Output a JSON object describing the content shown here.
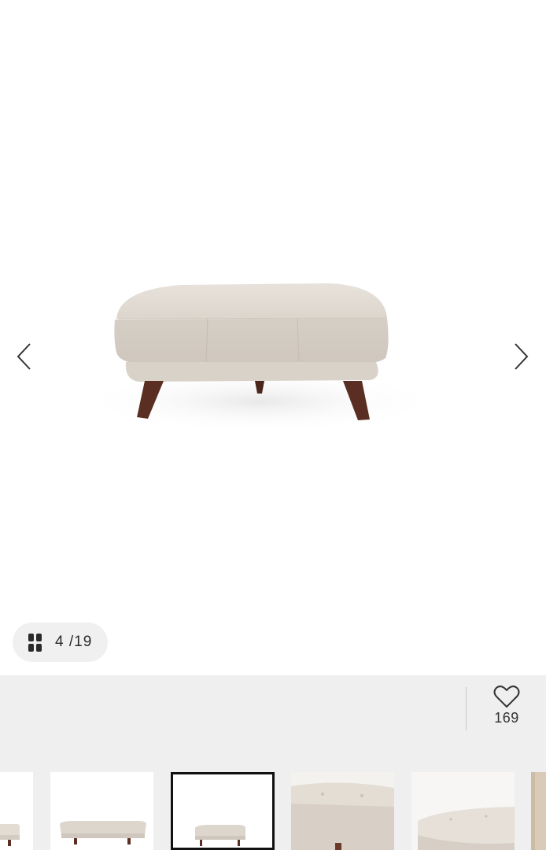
{
  "gallery": {
    "current": "4",
    "separator": "/",
    "total": "19",
    "prev_icon": "chevron-left-icon",
    "next_icon": "chevron-right-icon",
    "grid_icon": "grid-icon",
    "image_description_colors": {
      "fabric": "#ddd6cd",
      "legs": "#5a2e22"
    }
  },
  "favorite": {
    "icon": "heart-icon",
    "count": "169"
  },
  "thumbnails": {
    "active_index": 2,
    "count_visible": 6
  },
  "colors": {
    "bar_background": "#efefef",
    "active_border": "#111111"
  }
}
